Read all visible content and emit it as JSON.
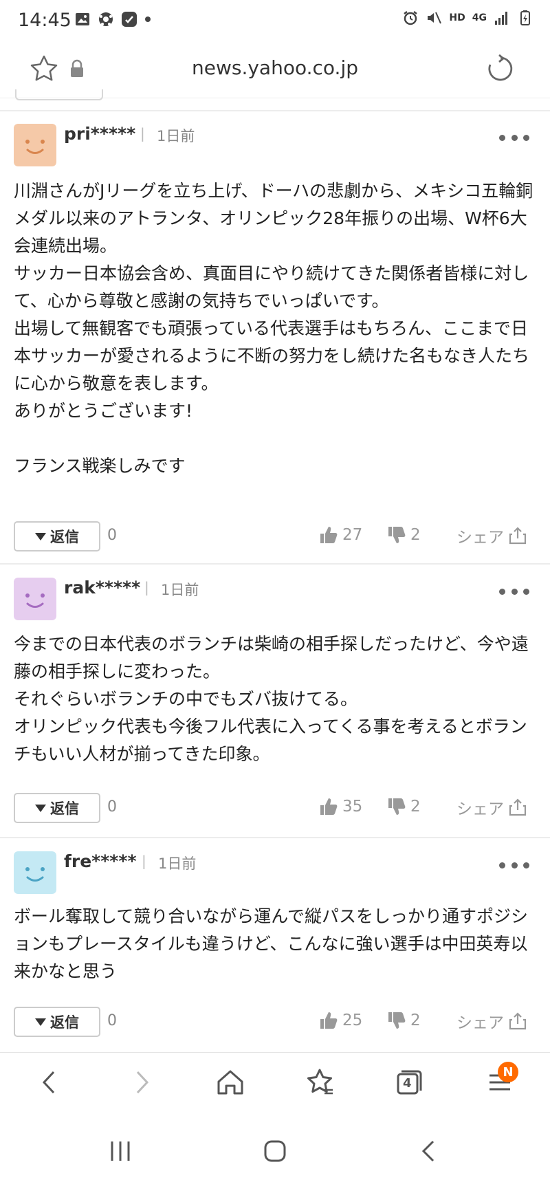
{
  "status_bar": {
    "time": "14:45",
    "network": "HD",
    "signal_label": "4G"
  },
  "url_bar": {
    "url": "news.yahoo.co.jp"
  },
  "comments": [
    {
      "username": "pri*****",
      "time_ago": "1日前",
      "avatar_color": "#f5c9a8",
      "avatar_face_color": "#d9864e",
      "body": "川淵さんがJリーグを立ち上げ、ドーハの悲劇から、メキシコ五輪銅メダル以来のアトランタ、オリンピック28年振りの出場、W杯6大会連続出場。\nサッカー日本協会含め、真面目にやり続けてきた関係者皆様に対して、心から尊敬と感謝の気持ちでいっぱいです。\n出場して無観客でも頑張っている代表選手はもちろん、ここまで日本サッカーが愛されるように不断の努力をし続けた名もなき人たちに心から敬意を表します。\nありがとうございます!\n\nフランス戦楽しみです",
      "reply_label": "返信",
      "reply_count": "0",
      "likes": "27",
      "dislikes": "2",
      "share_label": "シェア"
    },
    {
      "username": "rak*****",
      "time_ago": "1日前",
      "avatar_color": "#e6cdef",
      "avatar_face_color": "#a56bc0",
      "body": "今までの日本代表のボランチは柴崎の相手探しだったけど、今や遠藤の相手探しに変わった。\nそれぐらいボランチの中でもズバ抜けてる。\nオリンピック代表も今後フル代表に入ってくる事を考えるとボランチもいい人材が揃ってきた印象。",
      "reply_label": "返信",
      "reply_count": "0",
      "likes": "35",
      "dislikes": "2",
      "share_label": "シェア"
    },
    {
      "username": "fre*****",
      "time_ago": "1日前",
      "avatar_color": "#c4e9f4",
      "avatar_face_color": "#4aa3c4",
      "body": "ボール奪取して競り合いながら運んで縦パスをしっかり通すポジションもプレースタイルも違うけど、こんなに強い選手は中田英寿以来かなと思う",
      "reply_label": "返信",
      "reply_count": "0",
      "likes": "25",
      "dislikes": "2",
      "share_label": "シェア"
    }
  ],
  "bottom_nav": {
    "tabs_count": "4",
    "menu_badge": "N"
  },
  "colors": {
    "badge": "#ff6a00",
    "icon_gray": "#666666",
    "text": "#222222"
  }
}
